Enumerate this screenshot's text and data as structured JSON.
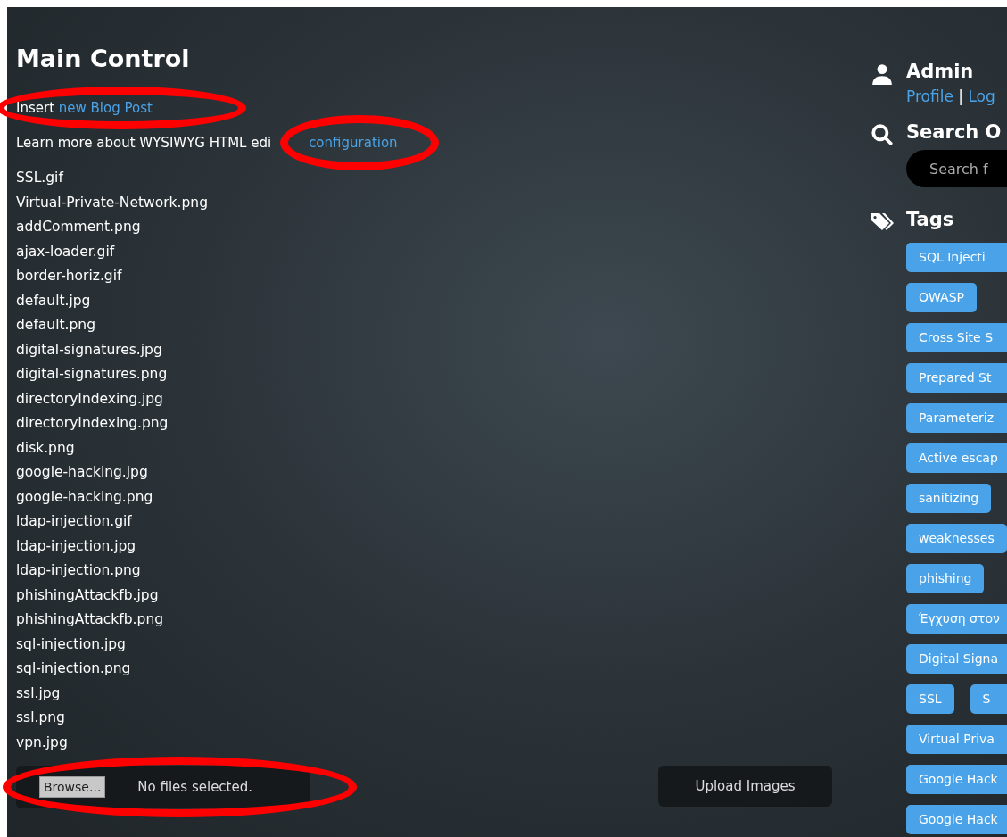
{
  "main": {
    "title": "Main Control",
    "insert_line": {
      "text": "Insert",
      "link": "new Blog Post",
      "circled": true
    },
    "editor_line": {
      "text": "Learn more about WYSIWYG HTML edi",
      "link": "configuration",
      "circled": true
    },
    "files": [
      "SSL.gif",
      "Virtual-Private-Network.png",
      "addComment.png",
      "ajax-loader.gif",
      "border-horiz.gif",
      "default.jpg",
      "default.png",
      "digital-signatures.jpg",
      "digital-signatures.png",
      "directoryIndexing.jpg",
      "directoryIndexing.png",
      "disk.png",
      "google-hacking.jpg",
      "google-hacking.png",
      "ldap-injection.gif",
      "ldap-injection.jpg",
      "ldap-injection.png",
      "phishingAttackfb.jpg",
      "phishingAttackfb.png",
      "sql-injection.jpg",
      "sql-injection.png",
      "ssl.jpg",
      "ssl.png",
      "vpn.jpg"
    ],
    "upload_form": {
      "browse": "Browse...",
      "status": "No files selected.",
      "submit": "Upload Images",
      "circled": true
    }
  },
  "sidebar": {
    "user": {
      "name": "Admin",
      "profile": "Profile",
      "separator": "|",
      "logout": "Log"
    },
    "search": {
      "title": "Search O",
      "placeholder": "Search f"
    },
    "tags": {
      "title": "Tags",
      "rows": [
        [
          "SQL Injecti"
        ],
        [
          "OWASP"
        ],
        [
          "Cross Site S"
        ],
        [
          "Prepared St"
        ],
        [
          "Parameteriz"
        ],
        [
          "Active escap"
        ],
        [
          "sanitizing"
        ],
        [
          "weaknesses"
        ],
        [
          "phishing"
        ],
        [
          "Έγχυση στον"
        ],
        [
          "Digital Signa"
        ],
        [
          "SSL",
          "S"
        ],
        [
          "Virtual Priva"
        ],
        [
          "Google Hack"
        ],
        [
          "Google Hack"
        ]
      ]
    }
  }
}
